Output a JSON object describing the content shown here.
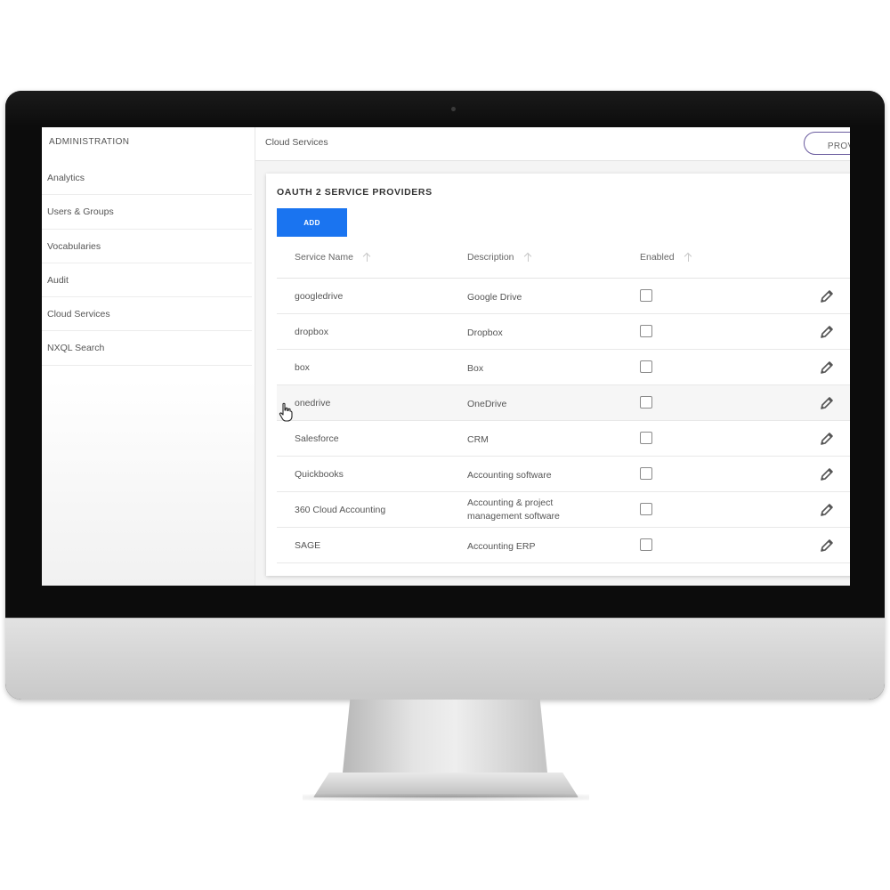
{
  "sidebar": {
    "header": "ADMINISTRATION",
    "items": [
      {
        "label": "Analytics"
      },
      {
        "label": "Users & Groups"
      },
      {
        "label": "Vocabularies"
      },
      {
        "label": "Audit"
      },
      {
        "label": "Cloud Services"
      },
      {
        "label": "NXQL Search"
      }
    ]
  },
  "topbar": {
    "title": "Cloud Services",
    "providers_button": "PROVID"
  },
  "card": {
    "title": "OAUTH 2 SERVICE PROVIDERS",
    "add_label": "ADD"
  },
  "table": {
    "columns": [
      {
        "label": "Service Name",
        "icon": "sort-arrow-up-icon"
      },
      {
        "label": "Description",
        "icon": "sort-arrow-up-icon"
      },
      {
        "label": "Enabled",
        "icon": "sort-arrow-up-icon"
      }
    ],
    "rows": [
      {
        "name": "googledrive",
        "description": "Google Drive",
        "enabled": false
      },
      {
        "name": "dropbox",
        "description": "Dropbox",
        "enabled": false
      },
      {
        "name": "box",
        "description": "Box",
        "enabled": false
      },
      {
        "name": "onedrive",
        "description": "OneDrive",
        "enabled": false
      },
      {
        "name": "Salesforce",
        "description": "CRM",
        "enabled": false
      },
      {
        "name": "Quickbooks",
        "description": "Accounting software",
        "enabled": false
      },
      {
        "name": "360 Cloud Accounting",
        "description": "Accounting & project management software",
        "enabled": false
      },
      {
        "name": "SAGE",
        "description": "Accounting ERP",
        "enabled": false
      }
    ]
  },
  "colors": {
    "accent": "#1a74f0",
    "providers_border": "#6a5b9e",
    "bezel": "#0c0c0c"
  },
  "icons": {
    "edit": "pencil-icon",
    "cursor": "hand-pointer-icon",
    "camera": "camera-icon"
  }
}
